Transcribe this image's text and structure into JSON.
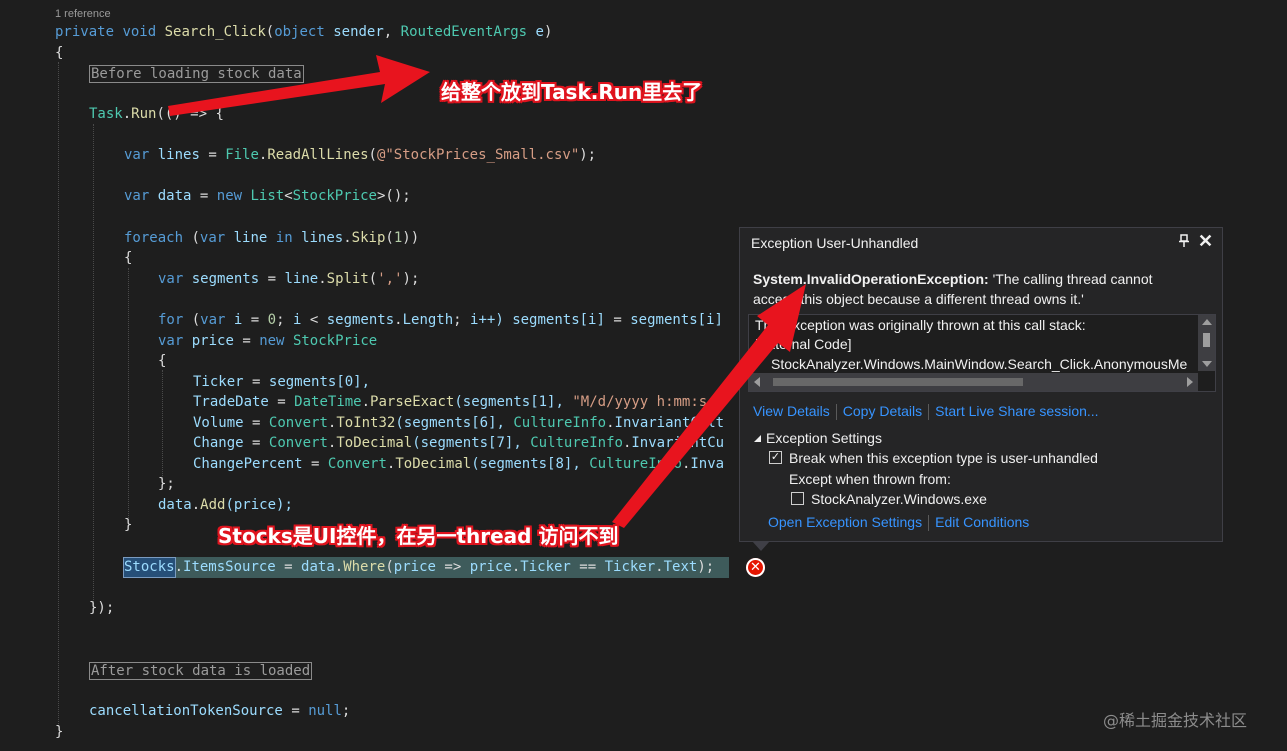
{
  "editor": {
    "reference_count": "1 reference",
    "code": {
      "signature": {
        "kw1": "private",
        "kw2": "void",
        "method": "Search_Click",
        "p1": "(",
        "kw3": "object",
        "param1": "sender",
        "comma": ",",
        "type1": "RoutedEventArgs",
        "param2": "e",
        "p2": ")"
      },
      "open_brace": "{",
      "region_before": "Before loading stock data",
      "task_run": {
        "ident": "Task",
        "dot": ".",
        "method": "Run",
        "rest": "(() => {"
      },
      "lines_decl": {
        "kw": "var",
        "name": "lines",
        "eq": "=",
        "cls": "File",
        "dot": ".",
        "method": "ReadAllLines",
        "open": "(",
        "str": "@\"StockPrices_Small.csv\"",
        "close": ");"
      },
      "data_decl": {
        "kw": "var",
        "name": "data",
        "eq": "=",
        "kw2": "new",
        "cls": "List",
        "lt": "<",
        "type": "StockPrice",
        "gt": ">",
        "close": "();"
      },
      "foreach": {
        "kw1": "foreach",
        "open": "(",
        "kw2": "var",
        "name": "line",
        "kw3": "in",
        "src": "lines",
        "dot": ".",
        "method": "Skip",
        "arg_open": "(",
        "num": "1",
        "close": "))"
      },
      "inner_open": "{",
      "segments_decl": {
        "kw": "var",
        "name": "segments",
        "eq": "=",
        "src": "line",
        "dot": ".",
        "method": "Split",
        "open": "(",
        "str": "','",
        "close": ");"
      },
      "for_loop": {
        "kw1": "for",
        "open": "(",
        "kw2": "var",
        "i": "i",
        "eq": "=",
        "num": "0",
        "semi": ";",
        "i2": "i",
        "lt": "<",
        "seg": "segments",
        "dot": ".",
        "len": "Length",
        "semi2": ";",
        "inc": "i++)",
        "lhs": "segments[i]",
        "eq2": "=",
        "rhs": "segments[i]"
      },
      "price_decl": {
        "kw": "var",
        "name": "price",
        "eq": "=",
        "kw2": "new",
        "type": "StockPrice"
      },
      "init_open": "{",
      "ticker_line": {
        "prop": "Ticker",
        "eq": "=",
        "val": "segments[0],",
        "extra": ""
      },
      "tradedate_line": {
        "prop": "TradeDate",
        "eq": "=",
        "cls": "DateTime",
        "dot": ".",
        "method": "ParseExact",
        "args": "(segments[1],",
        "str": "\"M/d/yyyy h:mm:s"
      },
      "volume_line": {
        "prop": "Volume",
        "eq": "=",
        "cls": "Convert",
        "dot": ".",
        "method": "ToInt32",
        "args": "(segments[6],",
        "cls2": "CultureInfo",
        "dot2": ".",
        "rest": "InvariantCult"
      },
      "change_line": {
        "prop": "Change",
        "eq": "=",
        "cls": "Convert",
        "dot": ".",
        "method": "ToDecimal",
        "args": "(segments[7],",
        "cls2": "CultureInfo",
        "dot2": ".",
        "rest": "InvariantCu"
      },
      "changepct_line": {
        "prop": "ChangePercent",
        "eq": "=",
        "cls": "Convert",
        "dot": ".",
        "method": "ToDecimal",
        "args": "(segments[8],",
        "cls2": "CultureInfo",
        "dot2": ".",
        "rest": "Inva"
      },
      "init_close": "};",
      "data_add": {
        "src": "data",
        "dot": ".",
        "method": "Add",
        "args": "(price);"
      },
      "inner_close": "}",
      "stocks_line": {
        "word": "Stocks",
        "dot": ".",
        "prop": "ItemsSource",
        "eq": "=",
        "src": "data",
        "dot2": ".",
        "method": "Where",
        "open": "(",
        "param": "price",
        "arrow": "=>",
        "p2": "price",
        "dot3": ".",
        "prop2": "Ticker",
        "eqeq": "==",
        "cls": "Ticker",
        "dot4": ".",
        "prop3": "Text",
        "close": ");"
      },
      "task_close": "});",
      "region_after": "After stock data is loaded",
      "cts_line": {
        "name": "cancellationTokenSource",
        "eq": "=",
        "kw": "null",
        "semi": ";"
      },
      "close_brace": "}"
    }
  },
  "popup": {
    "title": "Exception User-Unhandled",
    "pin_icon": "pin-icon",
    "close_icon": "close-icon",
    "exception_type": "System.InvalidOperationException:",
    "exception_message": " 'The calling thread cannot access this object because a different thread owns it.'",
    "stack_lines": [
      "This exception was originally thrown at this call stack:",
      "[External Code]",
      "StockAnalyzer.Windows.MainWindow.Search_Click.AnonymousMe"
    ],
    "links": [
      "View Details",
      "Copy Details",
      "Start Live Share session..."
    ],
    "settings_header": "Exception Settings",
    "break_label": "Break when this exception type is user-unhandled",
    "break_checked": true,
    "except_label": "Except when thrown from:",
    "module_label": "StockAnalyzer.Windows.exe",
    "module_checked": false,
    "bottom_links": [
      "Open Exception Settings",
      "Edit Conditions"
    ]
  },
  "annotations": {
    "top": "给整个放到Task.Run里去了",
    "bottom": "Stocks是UI控件，在另一thread 访问不到",
    "color": "#e0141e"
  },
  "watermark": "@稀土掘金技术社区",
  "colors": {
    "keyword": "#569cd6",
    "type": "#4ec9b0",
    "method": "#dcdcaa",
    "string": "#d69d85",
    "link": "#3794ff",
    "error": "#e51400"
  }
}
